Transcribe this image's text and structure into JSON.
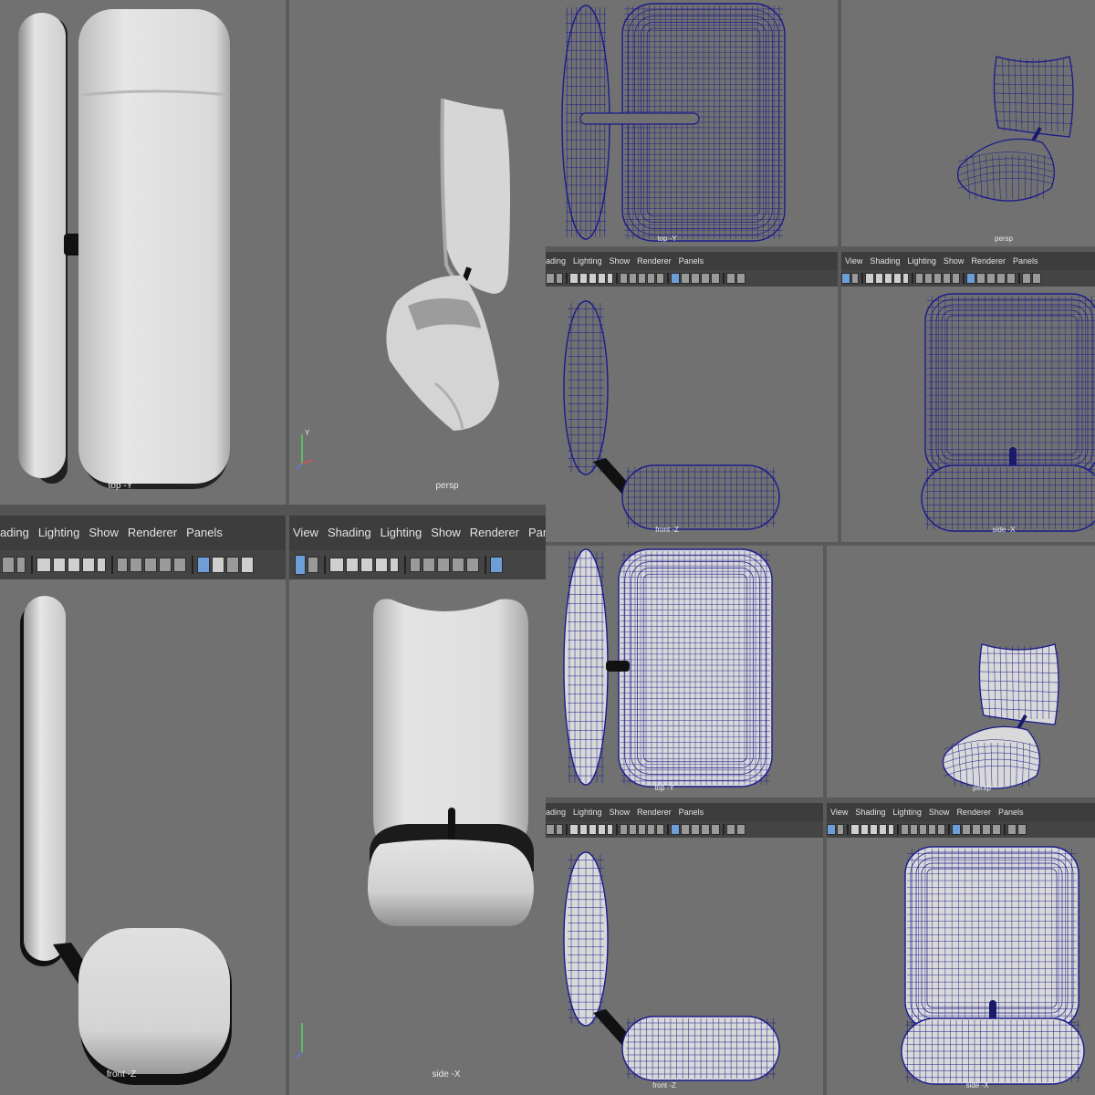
{
  "menu": {
    "view": "View",
    "shading": "Shading",
    "shading_cut": "ading",
    "lighting": "Lighting",
    "show": "Show",
    "renderer": "Renderer",
    "panels": "Panels"
  },
  "labels": {
    "top": "top -Y",
    "persp": "persp",
    "front": "front -Z",
    "side": "side -X"
  },
  "axis": {
    "y": "Y",
    "x": "X",
    "z": "Z"
  },
  "colors": {
    "viewport_bg": "#717171",
    "menubar_bg": "#3d3d3d",
    "wire": "#1a1a8c",
    "shaded": "#d9d9d9"
  }
}
